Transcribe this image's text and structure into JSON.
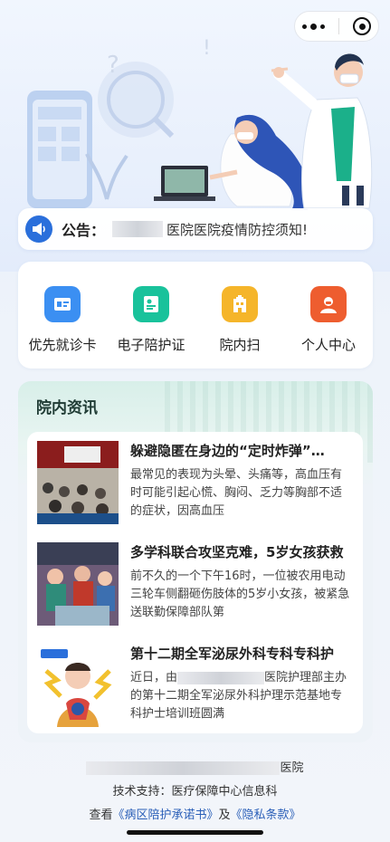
{
  "notice": {
    "label": "公告：",
    "text": "医院医院疫情防控须知!"
  },
  "actions": [
    {
      "label": "优先就诊卡",
      "icon": "id-card-icon",
      "color": "#3b8ff2"
    },
    {
      "label": "电子陪护证",
      "icon": "certificate-icon",
      "color": "#19c29b"
    },
    {
      "label": "院内扫",
      "icon": "hospital-scan-icon",
      "color": "#f5b52a"
    },
    {
      "label": "个人中心",
      "icon": "user-icon",
      "color": "#ee5d2f"
    }
  ],
  "news": {
    "title": "院内资讯",
    "items": [
      {
        "title": "躲避隐匿在身边的“定时炸弹”…",
        "desc": "最常见的表现为头晕、头痛等，高血压有时可能引起心慌、胸闷、乏力等胸部不适的症状，因高血压"
      },
      {
        "title": "多学科联合攻坚克难，5岁女孩获救",
        "desc": "前不久的一个下午16时，一位被农用电动三轮车侧翻砸伤肢体的5岁小女孩，被紧急送联勤保障部队第"
      },
      {
        "title": "第十二期全军泌尿外科专科专科护",
        "desc_prefix": "近日，由",
        "desc_mid": "医院护理部",
        "desc_rest": "主办的第十二期全军泌尿外科护理示范基地专科护士培训班圆满"
      }
    ]
  },
  "footer": {
    "hospital_suffix": "医院",
    "support": "技术支持：医疗保障中心信息科",
    "view_prefix": "查看",
    "promise_link": "《病区陪护承诺书》",
    "and": "及",
    "privacy_link": "《隐私条款》"
  }
}
